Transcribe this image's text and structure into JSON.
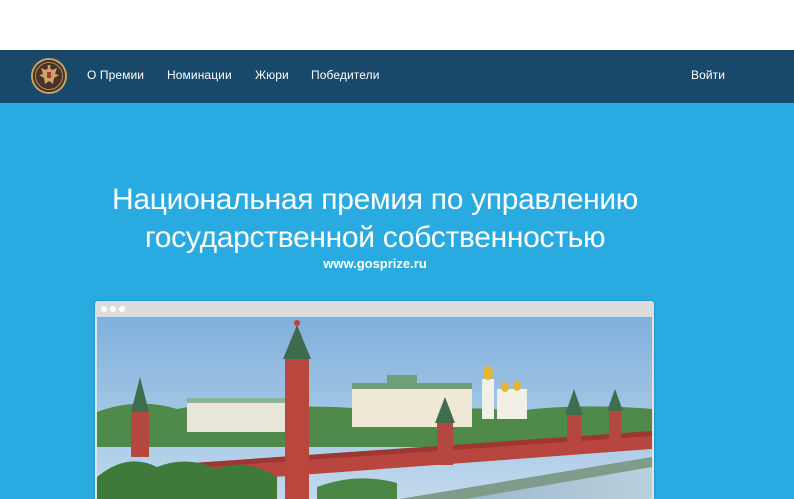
{
  "navbar": {
    "logo": {
      "icon": "coat-of-arms-icon"
    },
    "items": [
      {
        "label": "О Премии"
      },
      {
        "label": "Номинации"
      },
      {
        "label": "Жюри"
      },
      {
        "label": "Победители"
      }
    ],
    "login_label": "Войти"
  },
  "hero": {
    "title": "Национальная премия по управлению государственной собственностью",
    "url": "www.gosprize.ru",
    "video": {
      "icon": "kremlin-video-still"
    }
  },
  "colors": {
    "navbar_bg": "#18496b",
    "hero_bg": "#29aae1",
    "text": "#ffffff"
  }
}
